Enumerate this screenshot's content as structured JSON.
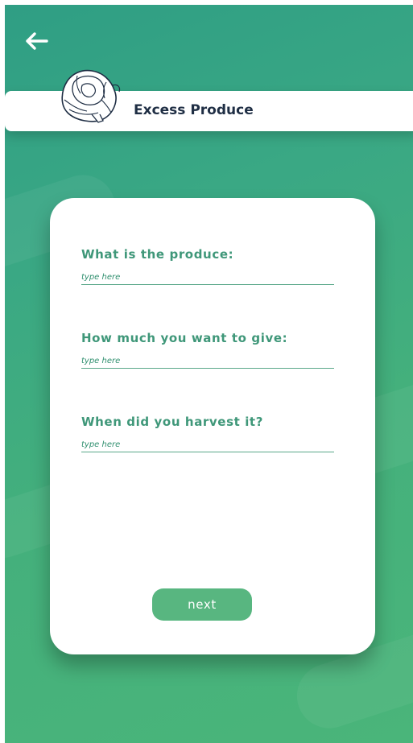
{
  "header": {
    "title": "Excess Produce",
    "icons": {
      "back": "arrow-left-icon",
      "produce": "cabbage-icon"
    }
  },
  "form": {
    "fields": [
      {
        "label": "What is the produce:",
        "placeholder": "type here",
        "value": ""
      },
      {
        "label": "How much you want to give:",
        "placeholder": "type here",
        "value": ""
      },
      {
        "label": "When did you harvest it?",
        "placeholder": "type here",
        "value": ""
      }
    ],
    "next_label": "next"
  },
  "colors": {
    "background_top": "#2f9e84",
    "background_bottom": "#4ab57a",
    "accent_text": "#2f8f6e",
    "button": "#58b680",
    "title_text": "#1f2e44"
  }
}
